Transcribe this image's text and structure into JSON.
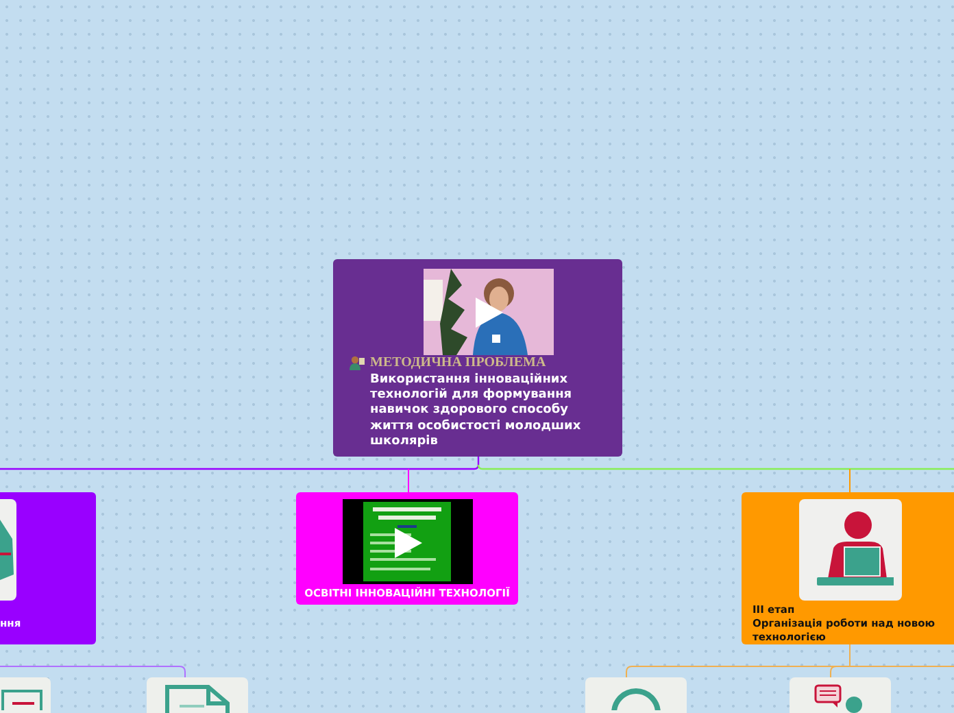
{
  "central": {
    "color": "#682e91",
    "heading": "МЕТОДИЧНА ПРОБЛЕМА",
    "text": [
      "Використання інноваційних",
      "технологій для формування",
      "навичок здорового способу",
      "життя особистості молодших",
      "школярів"
    ]
  },
  "nodes": [
    {
      "kind": "icon",
      "color": "#9900ff",
      "lines": [
        "ння"
      ]
    },
    {
      "kind": "video",
      "color": "#ff00ff",
      "lines": [
        "ОСВІТНІ ІННОВАЦІЙНІ ТЕХНОЛОГІЇ"
      ]
    },
    {
      "kind": "icon",
      "color": "#ff9900",
      "lines": [
        "III етап",
        "Організація роботи над новою",
        "технологією"
      ]
    }
  ]
}
